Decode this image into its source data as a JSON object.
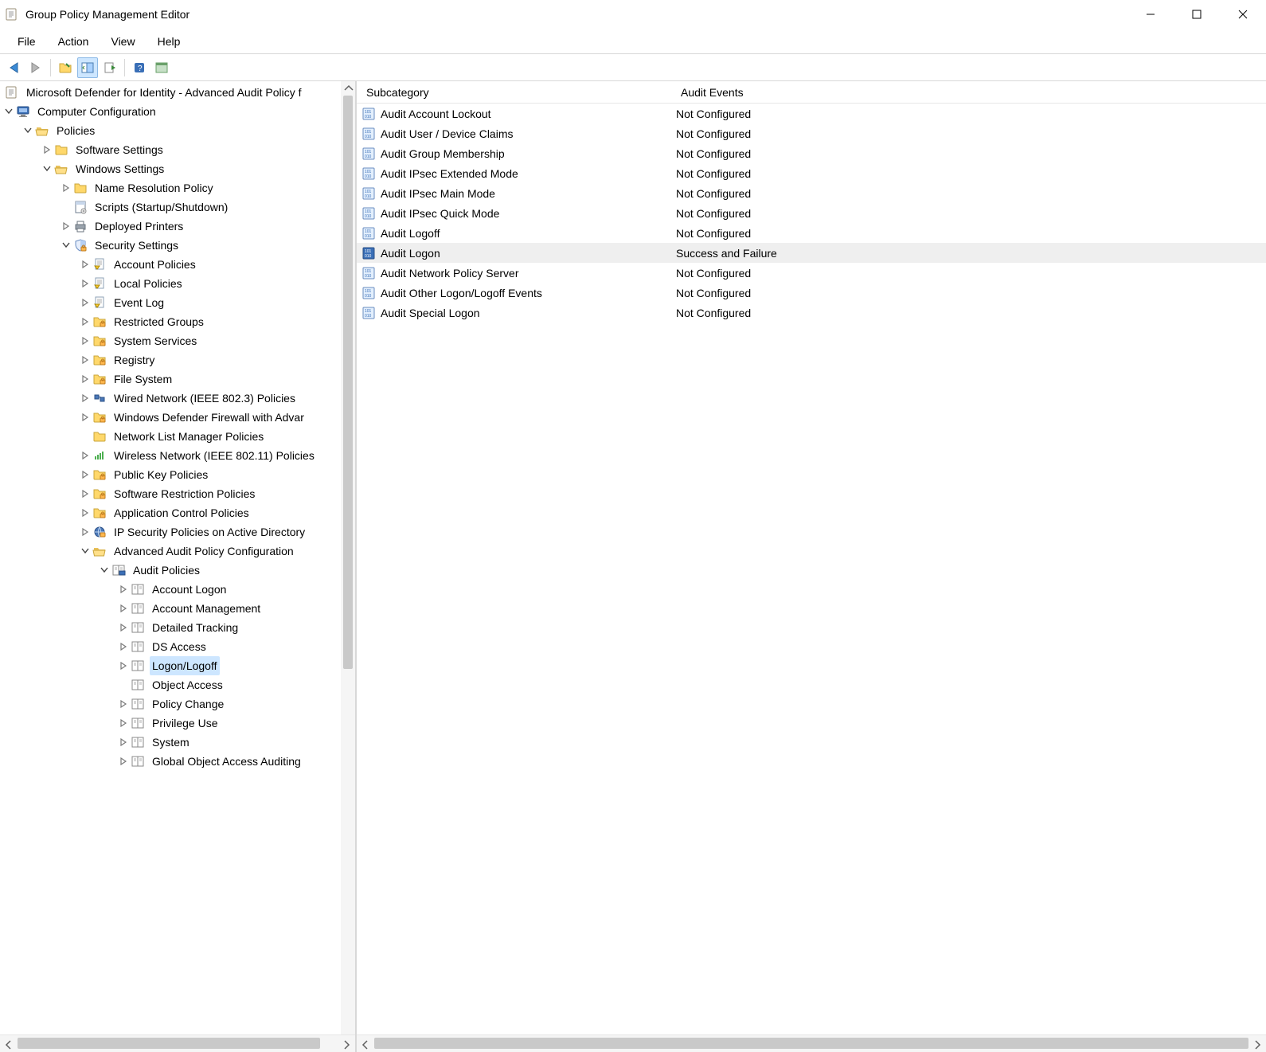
{
  "window": {
    "title": "Group Policy Management Editor"
  },
  "menu": [
    "File",
    "Action",
    "View",
    "Help"
  ],
  "toolbar_icons": [
    "back-icon",
    "forward-icon",
    "folder-up-icon",
    "show-hide-tree-icon",
    "export-list-icon",
    "help-icon",
    "options-icon"
  ],
  "tree": {
    "root_title": "Microsoft Defender for Identity - Advanced Audit Policy f",
    "computer_configuration": "Computer Configuration",
    "policies": "Policies",
    "software_settings": "Software Settings",
    "windows_settings": "Windows Settings",
    "name_resolution_policy": "Name Resolution Policy",
    "scripts": "Scripts (Startup/Shutdown)",
    "deployed_printers": "Deployed Printers",
    "security_settings": "Security Settings",
    "account_policies": "Account Policies",
    "local_policies": "Local Policies",
    "event_log": "Event Log",
    "restricted_groups": "Restricted Groups",
    "system_services": "System Services",
    "registry": "Registry",
    "file_system": "File System",
    "wired_network": "Wired Network (IEEE 802.3) Policies",
    "windows_defender_firewall": "Windows Defender Firewall with Advar",
    "network_list_manager": "Network List Manager Policies",
    "wireless_network": "Wireless Network (IEEE 802.11) Policies",
    "public_key_policies": "Public Key Policies",
    "software_restriction": "Software Restriction Policies",
    "application_control": "Application Control Policies",
    "ip_security": "IP Security Policies on Active Directory",
    "advanced_audit": "Advanced Audit Policy Configuration",
    "audit_policies": "Audit Policies",
    "audit_children": [
      "Account Logon",
      "Account Management",
      "Detailed Tracking",
      "DS Access",
      "Logon/Logoff",
      "Object Access",
      "Policy Change",
      "Privilege Use",
      "System",
      "Global Object Access Auditing"
    ],
    "selected_audit_index": 4
  },
  "list": {
    "columns": [
      "Subcategory",
      "Audit Events"
    ],
    "rows": [
      {
        "sub": "Audit Account Lockout",
        "ev": "Not Configured",
        "sel": false
      },
      {
        "sub": "Audit User / Device Claims",
        "ev": "Not Configured",
        "sel": false
      },
      {
        "sub": "Audit Group Membership",
        "ev": "Not Configured",
        "sel": false
      },
      {
        "sub": "Audit IPsec Extended Mode",
        "ev": "Not Configured",
        "sel": false
      },
      {
        "sub": "Audit IPsec Main Mode",
        "ev": "Not Configured",
        "sel": false
      },
      {
        "sub": "Audit IPsec Quick Mode",
        "ev": "Not Configured",
        "sel": false
      },
      {
        "sub": "Audit Logoff",
        "ev": "Not Configured",
        "sel": false
      },
      {
        "sub": "Audit Logon",
        "ev": "Success and Failure",
        "sel": true
      },
      {
        "sub": "Audit Network Policy Server",
        "ev": "Not Configured",
        "sel": false
      },
      {
        "sub": "Audit Other Logon/Logoff Events",
        "ev": "Not Configured",
        "sel": false
      },
      {
        "sub": "Audit Special Logon",
        "ev": "Not Configured",
        "sel": false
      }
    ]
  }
}
